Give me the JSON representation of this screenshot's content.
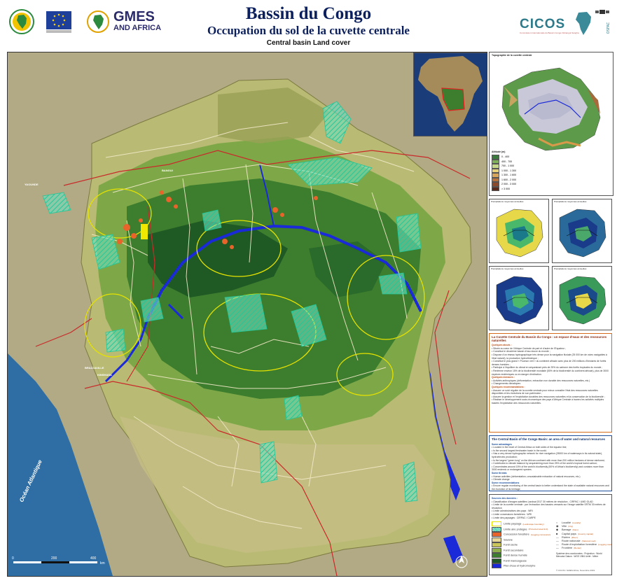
{
  "header": {
    "title": "Bassin du Congo",
    "subtitle": "Occupation du sol de la cuvette centrale",
    "subtitle_en": "Central basin Land cover",
    "logo_left_1": "AU",
    "logo_gmes_1": "GMES",
    "logo_gmes_2": "AND AFRICA",
    "logo_cicos": "CICOS",
    "logo_cicos_sub": "Commission Internationale du Bassin Congo-Oubangui-Sangha"
  },
  "map": {
    "ocean_label": "Océan Atlantique",
    "cities": {
      "yaounde": "YAOUNDE",
      "bangui": "BANGUI",
      "brazzaville": "BRAZZAVILLE",
      "kinshasa": "KINSHASA"
    },
    "scale_labels": [
      "0",
      "200",
      "400"
    ],
    "scale_unit": "km"
  },
  "sidebar": {
    "topo_title": "Topographie de la cuvette centrale",
    "altitude_title": "Altitude (m)",
    "altitude_classes": [
      {
        "label": "0 - 400",
        "color": "#3a7a3c"
      },
      {
        "label": "400 - 700",
        "color": "#7fb05a"
      },
      {
        "label": "700 - 1 000",
        "color": "#c5d88a"
      },
      {
        "label": "1 000 - 1 300",
        "color": "#e8d27a"
      },
      {
        "label": "1 300 - 1 600",
        "color": "#d8a65a"
      },
      {
        "label": "1 600 - 2 000",
        "color": "#b9733c"
      },
      {
        "label": "2 000 - 3 000",
        "color": "#8c4a2a"
      },
      {
        "label": "> 3 000",
        "color": "#5a2a1a"
      }
    ],
    "precip_titles": [
      "Précipitations moyennes annuelles",
      "Précipitations moyennes annuelles",
      "Précipitations moyennes annuelles",
      "Précipitations moyennes annuelles"
    ],
    "fr_heading": "La Cuvette Centrale du Bassin du Congo : un espace d'eaux et des ressources naturelles",
    "fr_sub1": "Quelques atouts :",
    "fr_items1": [
      "Située au cœur de l'Afrique Centrale de part et d'autre de l'Equateur ;",
      "Constitue le deuxième bassin d'eau douce du monde ;",
      "Dispose d'un réseau hydrographique très dense pour la navigation fluviale (25 000 km de voies navigables à l'état naturel), la production hydroélectrique ;",
      "Constitue le plus grand « Poumon vert » du continent africain avec plus de 200 millions d'hectares de forêts denses humides ;",
      "Participe à l'équilibre du climat en séquestrant près de 25% du carbone des forêts tropicales du monde ;",
      "Renferme environ 15% de la biodiversité mondiale (50% de la biodiversité du continent africain), plus de 3000 espèces endémiques ou en danger d'extinction."
    ],
    "fr_sub2": "Quelques menaces :",
    "fr_items2": [
      "Activités anthropiques (déforestation, extraction non durable des ressources naturelles, etc.)",
      "Changements climatiques"
    ],
    "fr_sub3": "Quelques recommandations :",
    "fr_items3": [
      "Assurer un suivi régulier de la cuvette centrale pour mieux connaître l'état des ressources naturelles disponibles et les évolutions de son patrimoine ;",
      "Assurer la gestion et l'exploitation durables des ressources naturelles et la conservation de la biodiversité ;",
      "Réaliser le développement socio-économique des pays d'Afrique Centrale à travers les activités multiples basées l'exploitation des ressources naturelles."
    ],
    "en_heading": "The Central Basin of the Congo Basin: an area of water and natural resources",
    "en_sub1": "Some advantages",
    "en_items1": [
      "Located in the heart of Central Africa on both sides of the equator line;",
      "Is the second largest freshwater basin in the world;",
      "Has a very dense hydrographic network for river navigation (25000 km of waterways in its natural state), hydroelectric production;",
      "Is the largest \"green lung\" on the African continent with more than 200 million hectares of dense rainforest;",
      "Contributes to climate balance by sequestering more than 25% of the world's tropical forest carbon;",
      "Concentrates around 15% of the world's biodiversity (50% of Africa's biodiversity) and contains more than 3000 endemic or endangered species."
    ],
    "en_sub2": "Some threats",
    "en_items2": [
      "Human activities (deforestation, unsustainable extraction of natural resources, etc.)",
      "Climate change"
    ],
    "en_sub3": "Some recommendations",
    "en_items3": [
      "Ensure regular monitoring of the central basin to better understand the state of available natural resources and the evolution of its heritage;",
      "Ensure the management and sustainable exploitation of natural resources and the conservation of biodiversity;",
      "Realize the socio-economic development of the Central African countries through the multiple activities derived from the exploitation of the natural resources of the central basin."
    ],
    "sources_heading": "Sources des données :",
    "sources_items": [
      "Classification d'images satellites Landsat 2017 30 mètres de résolution - CIRPAC / UMD GLAD",
      "Limite de la cuvette centrale : par l'extraction des bassins versants sur l'image satellite SRTM 30 mètres de résolution",
      "Limite administratives des pays : WRI",
      "Limite concessions forestières : WRI",
      "Limite des paysages : CIRPAC / CARPE"
    ],
    "legend": {
      "items_left": [
        {
          "label": "Limite paysage",
          "sub": "(Landscape boundary)",
          "type": "line",
          "color": "#e6e200"
        },
        {
          "label": "Limite aire protégée",
          "sub": "(Protected area limit)",
          "type": "hatch",
          "color": "#27c6a0"
        },
        {
          "label": "Concession forestière",
          "sub": "(Logging concession)",
          "type": "fill",
          "color": "#e8642a"
        },
        {
          "label": "Savane",
          "sub": "",
          "type": "fill",
          "color": "#e7d89a"
        },
        {
          "label": "Forêt sèche",
          "sub": "",
          "type": "fill",
          "color": "#c9c55a"
        },
        {
          "label": "Forêt secondaire",
          "sub": "",
          "type": "fill",
          "color": "#8fb04a"
        },
        {
          "label": "Forêt dense humide",
          "sub": "",
          "type": "fill",
          "color": "#3d7d2e"
        },
        {
          "label": "Forêt marécageuse",
          "sub": "",
          "type": "fill",
          "color": "#1f5a24"
        },
        {
          "label": "Plan d'eau et hydromorphe",
          "sub": "",
          "type": "fill",
          "color": "#1a2ad8"
        }
      ],
      "items_right": [
        {
          "label": "Localité",
          "sub": "(Locality)",
          "symbol": "○"
        },
        {
          "label": "Ville",
          "sub": "(City)",
          "symbol": "◉"
        },
        {
          "label": "Barrage",
          "sub": "(Dam)",
          "symbol": "◆"
        },
        {
          "label": "Capital pays",
          "sub": "(Country capital)",
          "symbol": "■"
        },
        {
          "label": "Rivière",
          "sub": "(River)",
          "symbol": "—"
        },
        {
          "label": "Route nationale",
          "sub": "(National road)",
          "symbol": "—"
        },
        {
          "label": "Route d'exploitation forestière",
          "sub": "(Logging road)",
          "symbol": "—"
        },
        {
          "label": "Frontière",
          "sub": "(Border)",
          "symbol": "—"
        }
      ],
      "projection_text": "Système des coordonnées : Projection : World Mercator Datum : WGS 1984 Unité : Mètre",
      "credit": "© CICOS / GMES Africa, Novembre 2019"
    }
  }
}
